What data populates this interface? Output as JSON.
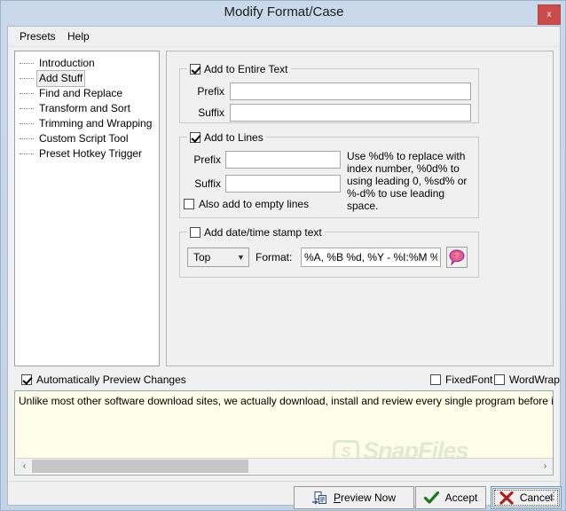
{
  "window": {
    "title": "Modify Format/Case",
    "close_label": "x"
  },
  "menubar": {
    "items": [
      {
        "label": "Presets"
      },
      {
        "label": "Help"
      }
    ]
  },
  "tree": {
    "items": [
      {
        "label": "Introduction",
        "selected": false
      },
      {
        "label": "Add Stuff",
        "selected": true
      },
      {
        "label": "Find and Replace",
        "selected": false
      },
      {
        "label": "Transform and Sort",
        "selected": false
      },
      {
        "label": "Trimming and Wrapping",
        "selected": false
      },
      {
        "label": "Custom Script Tool",
        "selected": false
      },
      {
        "label": "Preset Hotkey Trigger",
        "selected": false
      }
    ]
  },
  "entire_text_group": {
    "title": "Add to Entire Text",
    "checked": true,
    "prefix_label": "Prefix",
    "prefix_value": "",
    "suffix_label": "Suffix",
    "suffix_value": ""
  },
  "lines_group": {
    "title": "Add to Lines",
    "checked": true,
    "prefix_label": "Prefix",
    "prefix_value": "",
    "suffix_label": "Suffix",
    "suffix_value": "",
    "hint": "Use %d% to replace with index number, %0d% to using leading 0, %sd% or %-d% to use leading space.",
    "empty_lines_label": "Also add to empty lines",
    "empty_lines_checked": false
  },
  "datetime_group": {
    "title": "Add date/time stamp text",
    "checked": false,
    "position_value": "Top",
    "format_label": "Format:",
    "format_value": "%A, %B %d, %Y - %I:%M %p",
    "help_glyph": "?"
  },
  "preview_bar": {
    "auto_preview_label": "Automatically Preview Changes",
    "auto_preview_checked": true,
    "fixed_font_label": "FixedFont",
    "fixed_font_checked": false,
    "word_wrap_label": "WordWrap",
    "word_wrap_checked": false
  },
  "preview": {
    "text": "Unlike most other software download sites, we actually download, install and review every single program before it is listed on the site.",
    "watermark": "SnapFiles",
    "watermark_logo": "S",
    "scroll_left_glyph": "‹",
    "scroll_right_glyph": "›"
  },
  "buttons": {
    "preview_now": "Preview Now",
    "accept": "Accept",
    "cancel": "Cancel"
  },
  "colors": {
    "titlebar": "#c5d6e8",
    "close_button": "#cb4b4b",
    "preview_background": "#fdfde8",
    "accept_check": "#1a7a1a",
    "cancel_cross": "#b01c1c",
    "watermark": "#9dbf9d"
  }
}
